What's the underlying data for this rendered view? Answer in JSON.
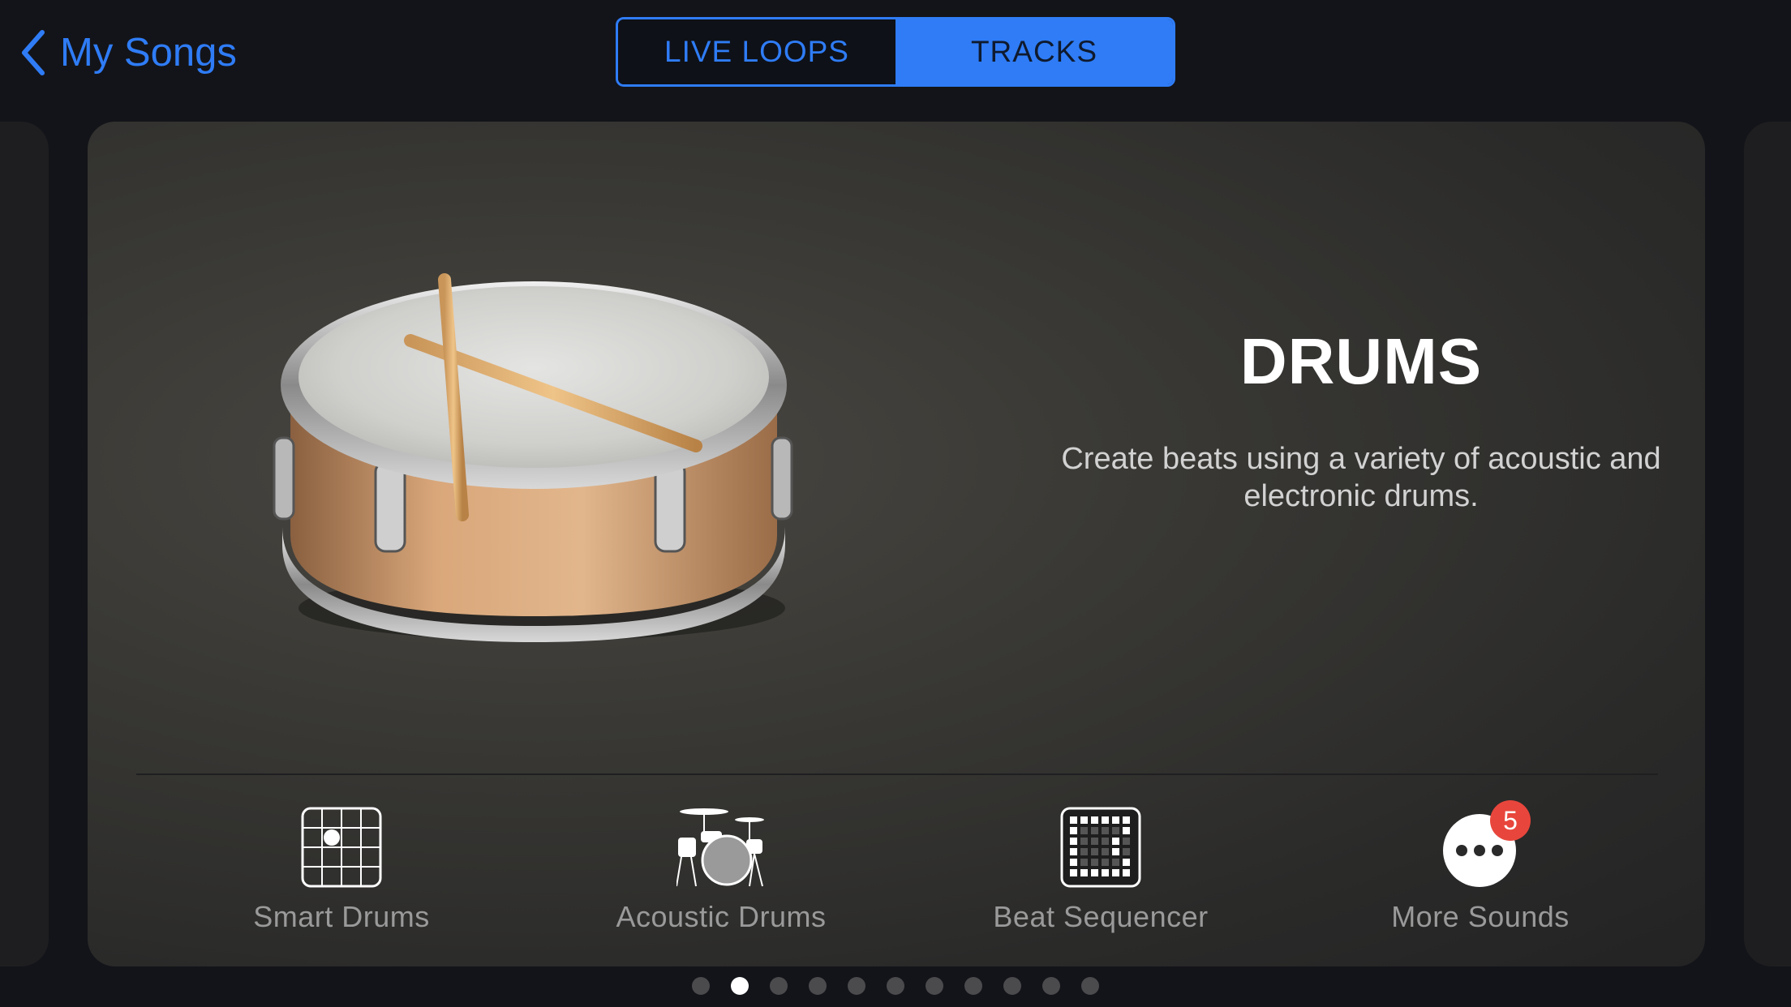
{
  "nav": {
    "back_label": "My Songs"
  },
  "segments": [
    {
      "label": "LIVE LOOPS",
      "selected": false
    },
    {
      "label": "TRACKS",
      "selected": true
    }
  ],
  "instrument": {
    "title": "DRUMS",
    "description_line1": "Create beats using a variety of acoustic and",
    "description_line2": "electronic drums."
  },
  "options": [
    {
      "label": "Smart Drums",
      "icon": "smart-drums-icon"
    },
    {
      "label": "Acoustic Drums",
      "icon": "drum-kit-icon"
    },
    {
      "label": "Beat Sequencer",
      "icon": "beat-sequencer-icon"
    },
    {
      "label": "More Sounds",
      "icon": "more-icon",
      "badge": "5"
    }
  ],
  "pager": {
    "count": 11,
    "active_index": 1
  },
  "colors": {
    "accent": "#2f7cf6",
    "badge": "#e8463c",
    "background": "#131419"
  }
}
